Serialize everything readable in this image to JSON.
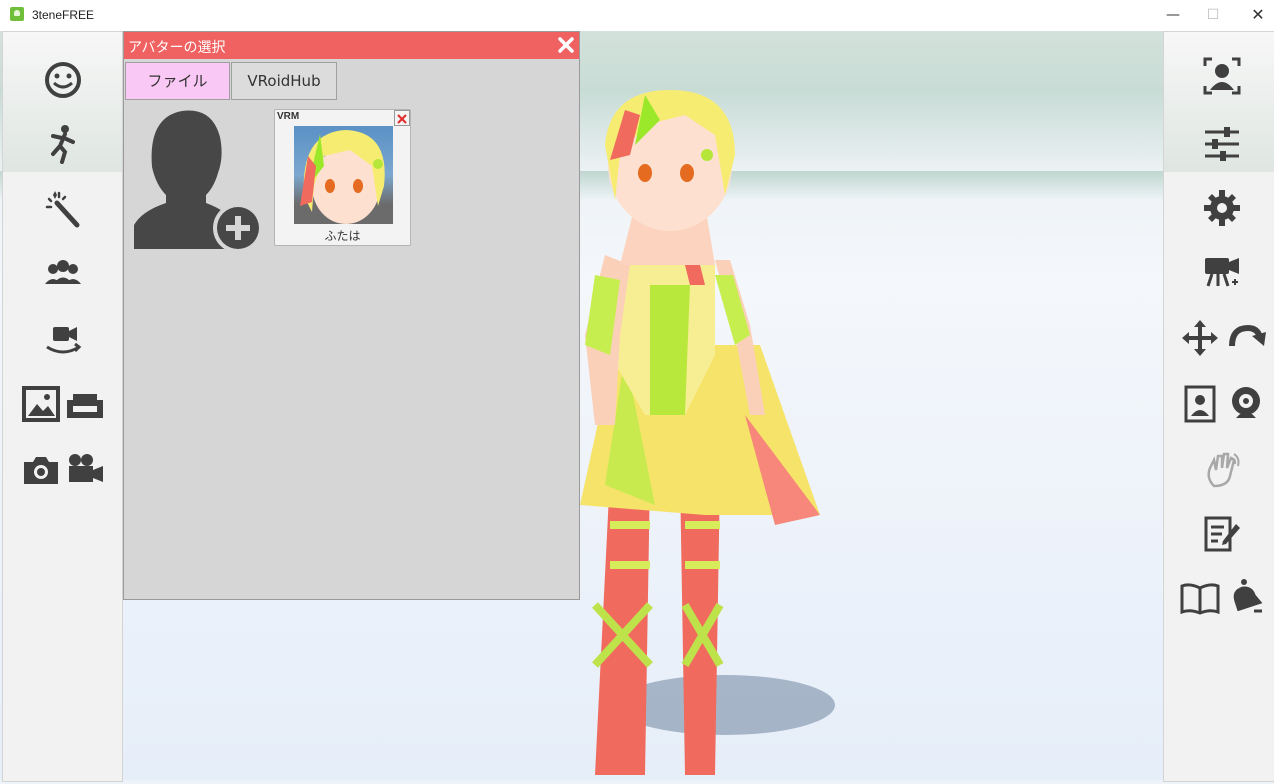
{
  "window": {
    "title": "3teneFREE",
    "minimize_glyph": "—",
    "maximize_glyph": "☐",
    "close_glyph": "✕"
  },
  "dialog": {
    "title": "アバターの選択",
    "tabs": [
      {
        "label": "ファイル",
        "active": true
      },
      {
        "label": "VRoidHub",
        "active": false
      }
    ],
    "avatars": [
      {
        "tag": "VRM",
        "name": "ふたは"
      }
    ]
  },
  "left_sidebar": {
    "icons": [
      "face-icon",
      "motion-icon",
      "magic-wand-icon",
      "group-icon",
      "camera-rotate-icon",
      "background-image-icon",
      "sofa-icon",
      "photo-camera-icon",
      "video-camera-icon"
    ]
  },
  "right_sidebar": {
    "icons": [
      "face-tracking-icon",
      "sliders-icon",
      "settings-gear-icon",
      "camera-move-icon",
      "move-arrows-icon",
      "rotate-icon",
      "portrait-icon",
      "webcam-icon",
      "hand-wave-icon",
      "edit-note-icon",
      "book-icon",
      "bell-icon"
    ]
  },
  "colors": {
    "dialog_header": "#f06262",
    "active_tab": "#f9c8f5",
    "icon": "#404040",
    "icon_disabled": "#a8a8a8"
  }
}
